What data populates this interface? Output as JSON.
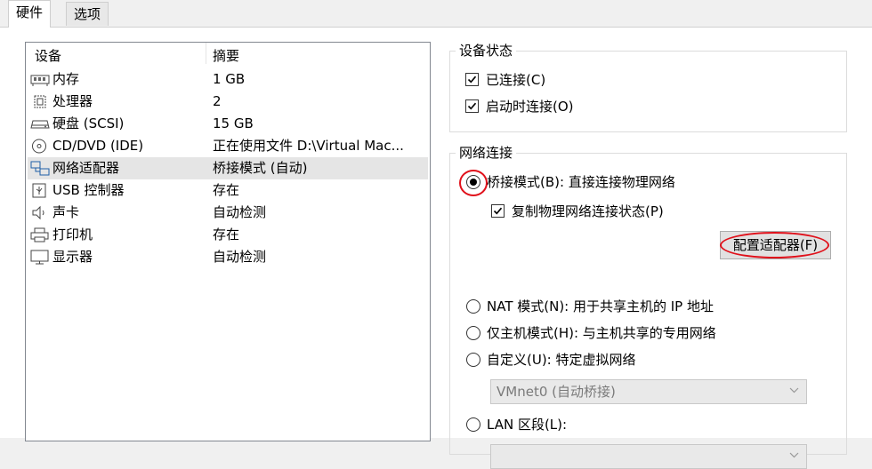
{
  "tabs": [
    {
      "label": "硬件",
      "active": true
    },
    {
      "label": "选项",
      "active": false
    }
  ],
  "device_list": {
    "headers": {
      "device": "设备",
      "summary": "摘要"
    },
    "rows": [
      {
        "icon": "memory-icon",
        "name": "内存",
        "summary": "1 GB"
      },
      {
        "icon": "processor-icon",
        "name": "处理器",
        "summary": "2"
      },
      {
        "icon": "hard-disk-icon",
        "name": "硬盘 (SCSI)",
        "summary": "15 GB"
      },
      {
        "icon": "cd-dvd-icon",
        "name": "CD/DVD (IDE)",
        "summary": "正在使用文件 D:\\Virtual Mac..."
      },
      {
        "icon": "network-adapter-icon",
        "name": "网络适配器",
        "summary": "桥接模式 (自动)",
        "selected": true
      },
      {
        "icon": "usb-icon",
        "name": "USB 控制器",
        "summary": "存在"
      },
      {
        "icon": "sound-card-icon",
        "name": "声卡",
        "summary": "自动检测"
      },
      {
        "icon": "printer-icon",
        "name": "打印机",
        "summary": "存在"
      },
      {
        "icon": "display-icon",
        "name": "显示器",
        "summary": "自动检测"
      }
    ]
  },
  "device_status": {
    "title": "设备状态",
    "connected": {
      "label": "已连接(C)",
      "checked": true
    },
    "connect_at_power_on": {
      "label": "启动时连接(O)",
      "checked": true
    }
  },
  "network_connection": {
    "title": "网络连接",
    "bridged": {
      "label": "桥接模式(B): 直接连接物理网络",
      "selected": true
    },
    "replicate_state": {
      "label": "复制物理网络连接状态(P)",
      "checked": true
    },
    "configure_adapters_label": "配置适配器(F)",
    "nat": {
      "label": "NAT 模式(N): 用于共享主机的 IP 地址",
      "selected": false
    },
    "host_only": {
      "label": "仅主机模式(H): 与主机共享的专用网络",
      "selected": false
    },
    "custom": {
      "label": "自定义(U): 特定虚拟网络",
      "selected": false
    },
    "custom_select_value": "VMnet0 (自动桥接)",
    "lan_segment": {
      "label": "LAN 区段(L):",
      "selected": false
    },
    "lan_select_value": ""
  },
  "colors": {
    "highlight_ring": "#e0101a",
    "selected_row": "#e5e5e5"
  }
}
